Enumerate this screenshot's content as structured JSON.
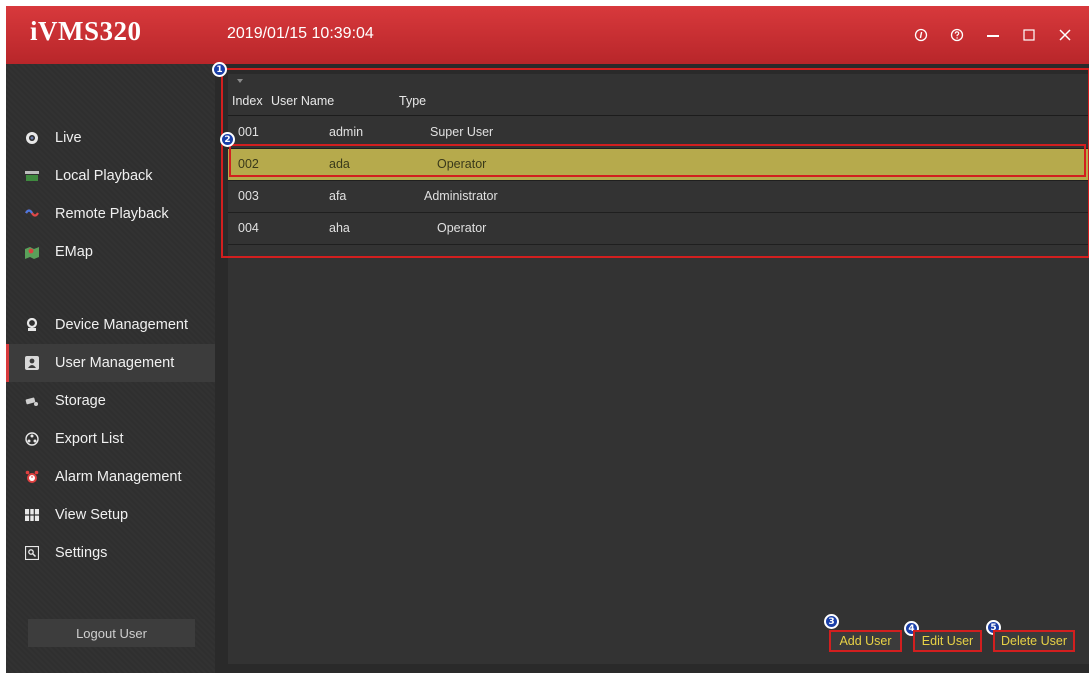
{
  "app": {
    "logo": "iVMS320",
    "datetime": "2019/01/15 10:39:04"
  },
  "window_controls": [
    {
      "name": "about-icon"
    },
    {
      "name": "help-icon"
    },
    {
      "name": "minimize-icon"
    },
    {
      "name": "maximize-icon"
    },
    {
      "name": "close-icon"
    }
  ],
  "sidebar": {
    "group1": [
      {
        "label": "Live",
        "icon": "live-icon"
      },
      {
        "label": "Local Playback",
        "icon": "local-playback-icon"
      },
      {
        "label": "Remote Playback",
        "icon": "remote-playback-icon"
      },
      {
        "label": "EMap",
        "icon": "emap-icon"
      }
    ],
    "group2": [
      {
        "label": "Device Management",
        "icon": "device-icon"
      },
      {
        "label": "User Management",
        "icon": "user-icon",
        "active": true
      },
      {
        "label": "Storage",
        "icon": "storage-icon"
      },
      {
        "label": "Export List",
        "icon": "export-icon"
      },
      {
        "label": "Alarm Management",
        "icon": "alarm-icon"
      },
      {
        "label": "View Setup",
        "icon": "view-setup-icon"
      },
      {
        "label": "Settings",
        "icon": "settings-icon"
      }
    ],
    "logout": "Logout User"
  },
  "table": {
    "headers": {
      "index": "Index",
      "user_name": "User Name",
      "type": "Type"
    },
    "rows": [
      {
        "index": "001",
        "user_name": "admin",
        "type": "Super User"
      },
      {
        "index": "002",
        "user_name": "ada",
        "type": "Operator",
        "selected": true
      },
      {
        "index": "003",
        "user_name": "afa",
        "type": "Administrator"
      },
      {
        "index": "004",
        "user_name": "aha",
        "type": "Operator"
      }
    ]
  },
  "actions": {
    "add": "Add User",
    "edit": "Edit User",
    "delete": "Delete User"
  },
  "annotations": [
    "1",
    "2",
    "3",
    "4",
    "5"
  ],
  "colors": {
    "titlebar": "#c8302f",
    "selected_row": "#b6aa4c",
    "annotation": "#d21f1f",
    "badge": "#1a3fa8",
    "button_text": "#e8d246"
  }
}
